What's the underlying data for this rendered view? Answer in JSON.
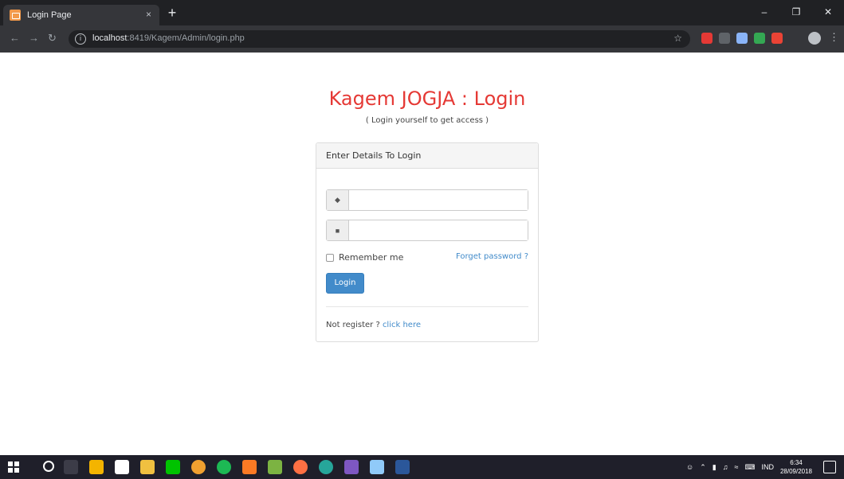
{
  "browser": {
    "tab_title": "Login Page",
    "tab_close": "×",
    "new_tab": "+",
    "url_host": "localhost",
    "url_path": ":8419/Kagem/Admin/login.php",
    "window_minimize": "–",
    "window_restore": "❐",
    "window_close": "✕"
  },
  "page": {
    "title": "Kagem JOGJA : Login",
    "subtitle": "( Login yourself to get access )",
    "panel_heading": "Enter Details To Login",
    "username_value": "",
    "password_value": "",
    "remember_label": "Remember me",
    "forget_label": "Forget password ?",
    "login_button": "Login",
    "register_prompt": "Not register ? ",
    "register_link": "click here"
  },
  "taskbar": {
    "language": "IND",
    "time": "6:34",
    "date": "28/09/2018"
  },
  "colors": {
    "title": "#e53935",
    "primary": "#428bca",
    "chrome_dark": "#202124",
    "taskbar": "#1f1f2a"
  }
}
